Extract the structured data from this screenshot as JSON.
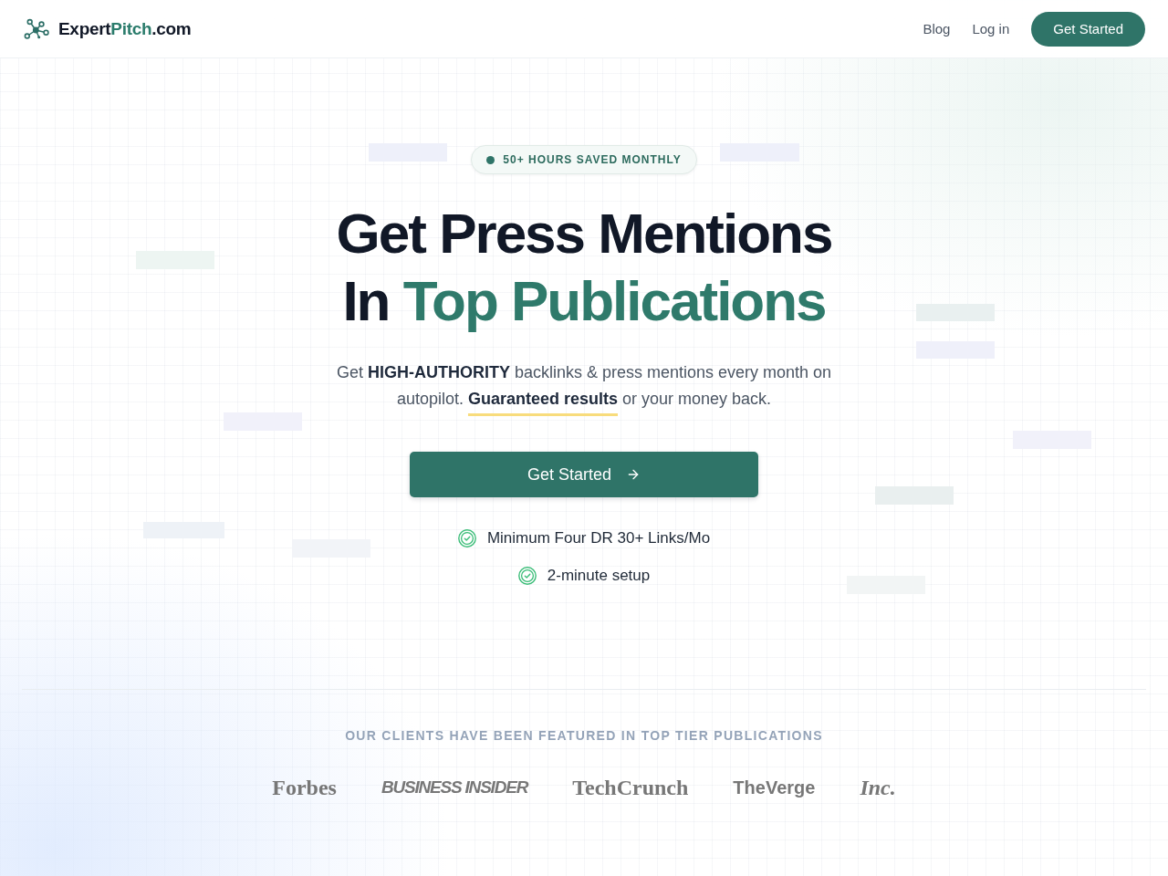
{
  "header": {
    "logo": {
      "parts": [
        {
          "text": "Expert",
          "accent": false
        },
        {
          "text": "Pitch",
          "accent": true
        },
        {
          "text": ".com",
          "accent": false
        }
      ]
    },
    "nav_links": [
      "Blog",
      "Log in"
    ],
    "cta": "Get Started"
  },
  "hero": {
    "badge": "50+ HOURS SAVED MONTHLY",
    "headline": {
      "line_1": "Get Press Mentions",
      "line_2": [
        {
          "text": "In",
          "accent": false
        },
        {
          "text": "Top Publications",
          "accent": true
        }
      ]
    },
    "subtitle": "Get **HIGH-AUTHORITY** backlinks & press mentions every month on autopilot. **Guaranteed results** or your money back.",
    "cta": "Get Started",
    "features": [
      "Minimum Four DR 30+ Links/Mo",
      "2-minute setup"
    ]
  },
  "social_proof": {
    "label": "OUR CLIENTS HAVE BEEN FEATURED IN TOP TIER PUBLICATIONS",
    "publications": [
      {
        "name": "Forbes",
        "kind": "serif"
      },
      {
        "name": "BUSINESS INSIDER",
        "kind": "sans-italic"
      },
      {
        "name": "TechCrunch",
        "kind": "serif"
      },
      {
        "name": "TheVerge",
        "kind": "sans"
      },
      {
        "name": "Inc.",
        "kind": "serif-italic"
      }
    ]
  }
}
